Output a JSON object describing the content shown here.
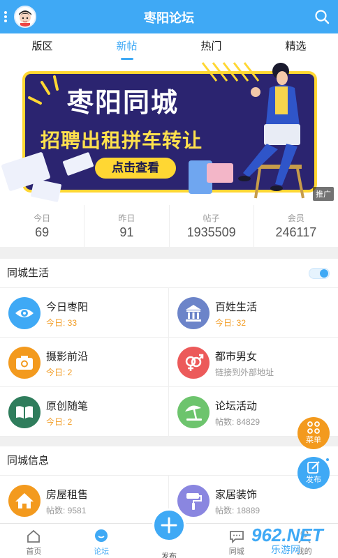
{
  "app": {
    "title": "枣阳论坛"
  },
  "tabs": [
    {
      "label": "版区"
    },
    {
      "label": "新帖"
    },
    {
      "label": "热门"
    },
    {
      "label": "精选"
    }
  ],
  "banner": {
    "title": "枣阳同城",
    "subtitle": "招聘出租拼车转让",
    "button": "点击查看",
    "ad_tag": "推广"
  },
  "stats": [
    {
      "label": "今日",
      "value": "69"
    },
    {
      "label": "昨日",
      "value": "91"
    },
    {
      "label": "帖子",
      "value": "1935509"
    },
    {
      "label": "会员",
      "value": "246117"
    }
  ],
  "sections": [
    {
      "title": "同城生活",
      "toggle_on": true,
      "items": [
        {
          "name": "今日枣阳",
          "sub": "今日: 33",
          "icon": "eye-icon",
          "color": "#3fa9f5",
          "sub_style": "orange"
        },
        {
          "name": "百姓生活",
          "sub": "今日: 32",
          "icon": "building-icon",
          "color": "#6c84c9",
          "sub_style": "orange"
        },
        {
          "name": "摄影前沿",
          "sub": "今日: 2",
          "icon": "camera-icon",
          "color": "#f39a1e",
          "sub_style": "orange"
        },
        {
          "name": "都市男女",
          "sub": "链接到外部地址",
          "icon": "gender-icon",
          "color": "#ec5a5a",
          "sub_style": "gray"
        },
        {
          "name": "原创随笔",
          "sub": "今日: 2",
          "icon": "book-icon",
          "color": "#2f7d5c",
          "sub_style": "orange"
        },
        {
          "name": "论坛活动",
          "sub": "帖数: 84829",
          "icon": "umbrella-icon",
          "color": "#6dc46d",
          "sub_style": "gray"
        }
      ]
    },
    {
      "title": "同城信息",
      "items": [
        {
          "name": "房屋租售",
          "sub": "帖数: 9581",
          "icon": "house-icon",
          "color": "#f39a1e",
          "sub_style": "gray"
        },
        {
          "name": "家居装饰",
          "sub": "帖数: 18889",
          "icon": "paint-roller-icon",
          "color": "#8a86e0",
          "sub_style": "gray"
        }
      ]
    }
  ],
  "fabs": {
    "menu": "菜单",
    "post": "发布"
  },
  "bottom_nav": [
    {
      "label": "首页",
      "icon": "home-icon"
    },
    {
      "label": "论坛",
      "icon": "chat-bubble-icon"
    },
    {
      "label": "发布",
      "icon": "plus-icon"
    },
    {
      "label": "同城",
      "icon": "message-icon"
    },
    {
      "label": "我的",
      "icon": "user-icon"
    }
  ],
  "watermark": {
    "brand": "962.NET",
    "site": "乐游网"
  },
  "colors": {
    "primary": "#3fa9f5",
    "orange": "#f39a1e",
    "banner_bg": "#2b2470"
  }
}
